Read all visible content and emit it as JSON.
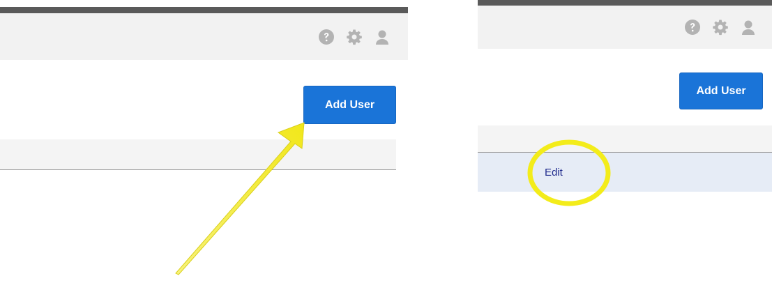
{
  "left_panel": {
    "header": {
      "icons": [
        "help-icon",
        "gear-icon",
        "user-icon"
      ]
    },
    "add_user_label": "Add User"
  },
  "right_panel": {
    "header": {
      "icons": [
        "help-icon",
        "gear-icon",
        "user-icon"
      ]
    },
    "add_user_label": "Add User",
    "row": {
      "edit_label": "Edit"
    }
  },
  "colors": {
    "accent_button": "#1a74d8",
    "annotation": "#f3ec1a",
    "header_bg": "#f2f2f2",
    "row_highlight": "#e6ecf6",
    "link": "#1f2a8c"
  }
}
